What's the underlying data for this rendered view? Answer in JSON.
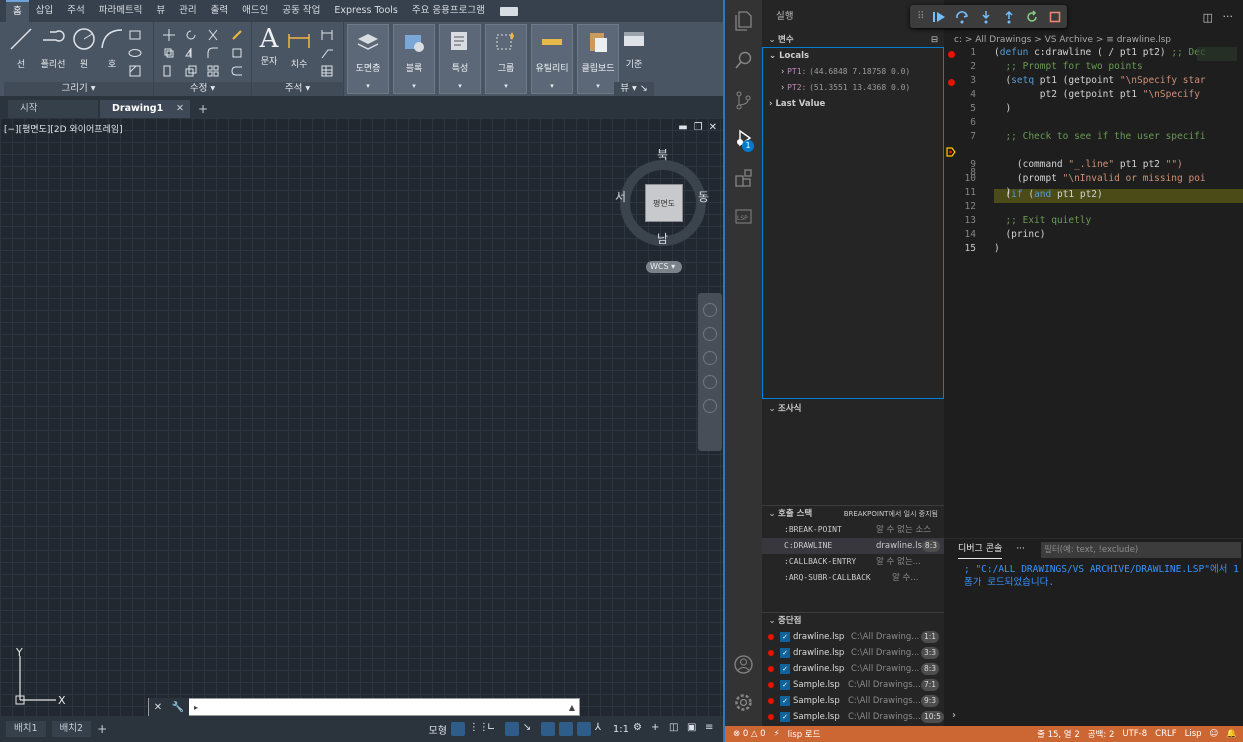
{
  "autocad": {
    "ribbon_tabs": [
      "홈",
      "삽입",
      "주석",
      "파라메트릭",
      "뷰",
      "관리",
      "출력",
      "애드인",
      "공동 작업",
      "Express Tools",
      "주요 응용프로그램"
    ],
    "draw_panel": {
      "title": "그리기",
      "line": "선",
      "polyline": "폴리선",
      "circle": "원",
      "arc": "호"
    },
    "modify_panel": {
      "title": "수정"
    },
    "annotation_panel": {
      "title": "주석",
      "text": "문자",
      "dimension": "치수"
    },
    "layers": "도면층",
    "block": "블록",
    "properties": "특성",
    "group": "그룹",
    "utilities": "유틸리티",
    "clipboard": "클립보드",
    "base": "기준",
    "view_panel": "뷰",
    "doc_tabs": {
      "start": "시작",
      "drawing": "Drawing1"
    },
    "viewport_label": "[−][평면도][2D 와이어프레임]",
    "viewcube": {
      "top": "평면도",
      "north": "북",
      "south": "남",
      "east": "동",
      "west": "서",
      "wcs": "WCS"
    },
    "ucs": {
      "x": "X",
      "y": "Y"
    },
    "layout_tabs": [
      "배치1",
      "배치2"
    ],
    "status_model": "모형",
    "status_scale": "1:1"
  },
  "vscode": {
    "sidebar_title": "실행",
    "variables": {
      "title": "변수",
      "locals": "Locals",
      "items": [
        {
          "name": "PT1:",
          "value": "(44.6848 7.18758 0.0)"
        },
        {
          "name": "PT2:",
          "value": "(51.3551 13.4368 0.0)"
        }
      ],
      "last_value": "Last Value"
    },
    "watch_title": "조사식",
    "callstack": {
      "title": "호출 스택",
      "status": "BREAKPOINT에서 일시 중지됨",
      "rows": [
        {
          "fn": ":BREAK-POINT",
          "src": "알 수 없는 소스",
          "badge": ""
        },
        {
          "fn": "C:DRAWLINE",
          "src": "drawline.lsp",
          "badge": "8:3"
        },
        {
          "fn": ":CALLBACK-ENTRY",
          "src": "알 수 없는...",
          "badge": ""
        },
        {
          "fn": ":ARQ-SUBR-CALLBACK",
          "src": "알 수...",
          "badge": ""
        }
      ]
    },
    "breakpoints": {
      "title": "중단점",
      "rows": [
        {
          "file": "drawline.lsp",
          "path": "C:\\All Drawing...",
          "pos": "1:1"
        },
        {
          "file": "drawline.lsp",
          "path": "C:\\All Drawing...",
          "pos": "3:3"
        },
        {
          "file": "drawline.lsp",
          "path": "C:\\All Drawing...",
          "pos": "8:3"
        },
        {
          "file": "Sample.lsp",
          "path": "C:\\All Drawings...",
          "pos": "7:1"
        },
        {
          "file": "Sample.lsp",
          "path": "C:\\All Drawings...",
          "pos": "9:3"
        },
        {
          "file": "Sample.lsp",
          "path": "C:\\All Drawings...",
          "pos": "10:5"
        }
      ]
    },
    "breadcrumb": "c: > All Drawings > VS Archive > ≡ drawline.lsp",
    "line_numbers": [
      "1",
      "2",
      "3",
      "4",
      "5",
      "6",
      "7",
      "8",
      "9",
      "10",
      "11",
      "12",
      "13",
      "14",
      "15"
    ],
    "code": {
      "l1a": "(",
      "l1b": "defun",
      "l1c": " c:drawline ( / pt1 pt2) ",
      "l1d": ";; Dec",
      "l2": "  ;; Prompt for two points",
      "l3a": "  (",
      "l3b": "setq",
      "l3c": " pt1 (getpoint ",
      "l3d": "\"\\nSpecify star",
      "l4a": "        pt2 (getpoint pt1 ",
      "l4b": "\"\\nSpecify",
      "l5": "  )",
      "l6": "",
      "l7": "  ;; Check to see if the user specifi",
      "l8a": "  (",
      "l8b": "if",
      "l8c": " (",
      "l8d": "and",
      "l8e": " pt1 pt2)",
      "l9a": "    (command ",
      "l9b": "\"_.line\"",
      "l9c": " pt1 pt2 ",
      "l9d": "\"\")",
      "l10a": "    (prompt ",
      "l10b": "\"\\nInvalid or missing poi",
      "l11": "  )",
      "l12": "",
      "l13": "  ;; Exit quietly",
      "l14": "  (princ)",
      "l15": ")"
    },
    "panel": {
      "tab": "디버그 콘솔",
      "more": "···",
      "filter_placeholder": "필터(예: text, !exclude)",
      "console_text": "; \"C:/ALL DRAWINGS/VS ARCHIVE/DRAWLINE.LSP\"에서 1 폼가 로드되었습니다."
    },
    "repl_prompt": "›",
    "status": {
      "errors": "⊗ 0 △ 0",
      "lisp_load": "lisp 로드",
      "position": "줄 15, 열 2",
      "spaces": "공백: 2",
      "encoding": "UTF-8",
      "eol": "CRLF",
      "language": "Lisp"
    },
    "activity_badge": "1"
  }
}
